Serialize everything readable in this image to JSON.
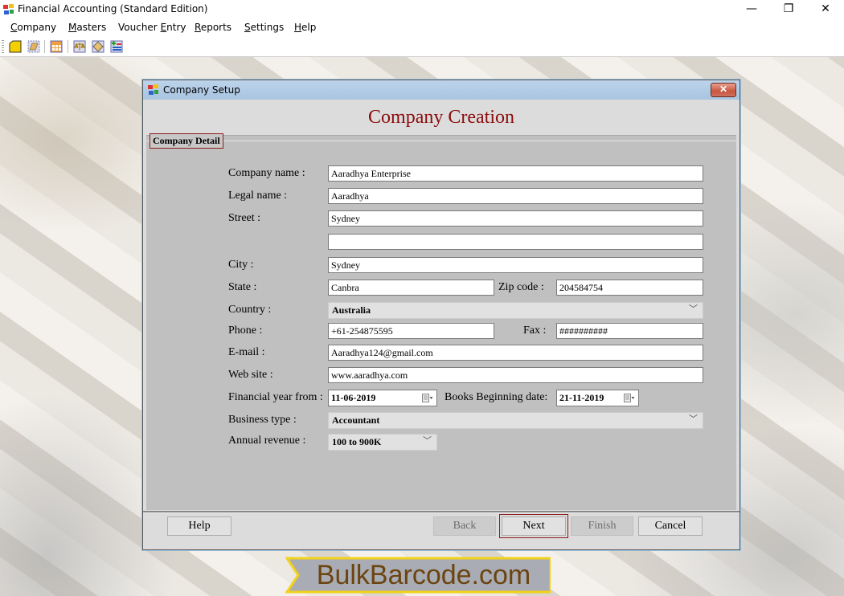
{
  "window": {
    "title": "Financial Accounting (Standard Edition)",
    "controls": {
      "minimize": "—",
      "maximize": "❐",
      "close": "✕"
    }
  },
  "menubar": {
    "items": [
      {
        "label": "Company",
        "accel": "C"
      },
      {
        "label": "Masters",
        "accel": "M"
      },
      {
        "label": "Voucher Entry",
        "accel": "E"
      },
      {
        "label": "Reports",
        "accel": "R"
      },
      {
        "label": "Settings",
        "accel": "S"
      },
      {
        "label": "Help",
        "accel": "H"
      }
    ]
  },
  "toolbar": {
    "buttons": [
      "new-company-icon",
      "open-company-icon",
      "calculator-icon",
      "balance-scale-icon",
      "ledger-icon",
      "add-entry-icon"
    ]
  },
  "dialog": {
    "title": "Company Setup",
    "close_label": "✕",
    "heading": "Company Creation",
    "group_label": "Company Detail",
    "labels": {
      "company_name": "Company name :",
      "legal_name": "Legal name :",
      "street": "Street :",
      "city": "City :",
      "state": "State :",
      "zip": "Zip code :",
      "country": "Country :",
      "phone": "Phone :",
      "fax": "Fax :",
      "email": "E-mail :",
      "website": "Web site :",
      "fy_from": "Financial year from :",
      "books_begin": "Books Beginning date:",
      "business_type": "Business type :",
      "annual_revenue": "Annual revenue :"
    },
    "values": {
      "company_name": "Aaradhya Enterprise",
      "legal_name": "Aaradhya",
      "street1": "Sydney",
      "street2": "",
      "city": "Sydney",
      "state": "Canbra",
      "zip": "204584754",
      "country": "Australia",
      "phone": "+61-254875595",
      "fax": "##########",
      "email": "Aaradhya124@gmail.com",
      "website": "www.aaradhya.com",
      "fy_from": "11-06-2019",
      "books_begin": "21-11-2019",
      "business_type": "Accountant",
      "annual_revenue": "100 to 900K"
    },
    "buttons": {
      "help": "Help",
      "back": "Back",
      "next": "Next",
      "finish": "Finish",
      "cancel": "Cancel"
    }
  },
  "banner": {
    "text": "BulkBarcode.com",
    "colors": {
      "fill": "#a9acb4",
      "border": "#f2d21a",
      "text": "#6b4410"
    }
  }
}
